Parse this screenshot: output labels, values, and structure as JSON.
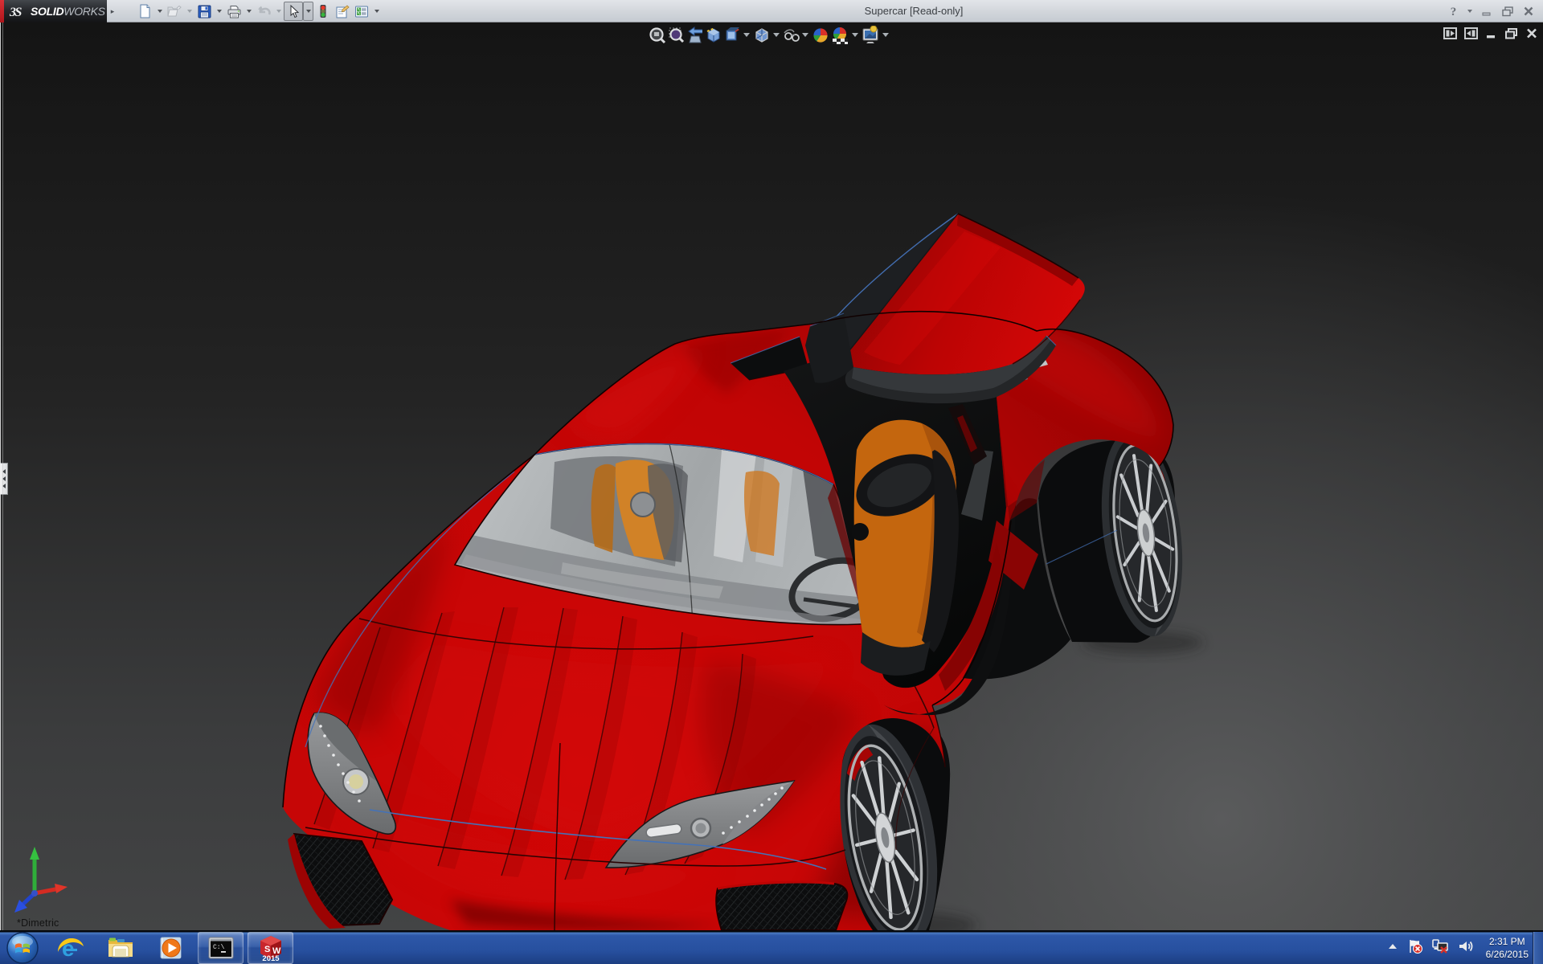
{
  "window": {
    "title": "Supercar [Read-only]",
    "brand": {
      "logo_glyph": "3S",
      "name_bold": "SOLID",
      "name_light": "WORKS",
      "flyout": "▸"
    },
    "controls": [
      {
        "name": "help-button",
        "label": "?"
      },
      {
        "name": "help-dropdown",
        "label": "▾"
      },
      {
        "name": "minimize-button",
        "label": "–"
      },
      {
        "name": "restore-button",
        "label": "⧉"
      },
      {
        "name": "close-button",
        "label": "✕"
      }
    ]
  },
  "quick_toolbar": {
    "items": [
      {
        "name": "new-document",
        "enabled": true,
        "has_dropdown": true
      },
      {
        "name": "open-document",
        "enabled": false,
        "has_dropdown": true
      },
      {
        "name": "save",
        "enabled": true,
        "has_dropdown": true
      },
      {
        "name": "print",
        "enabled": true,
        "has_dropdown": true
      },
      {
        "name": "undo",
        "enabled": false,
        "has_dropdown": true
      },
      {
        "name": "select",
        "enabled": true,
        "pressed": true,
        "has_dropdown": true
      },
      {
        "name": "rebuild",
        "enabled": true,
        "has_dropdown": false
      },
      {
        "name": "file-properties",
        "enabled": true,
        "has_dropdown": false
      },
      {
        "name": "options",
        "enabled": true,
        "has_dropdown": true
      }
    ]
  },
  "headsup_toolbar": {
    "items": [
      {
        "name": "zoom-to-fit"
      },
      {
        "name": "zoom-to-area"
      },
      {
        "name": "previous-view"
      },
      {
        "name": "section-view"
      },
      {
        "name": "view-orientation",
        "has_dropdown": true
      },
      {
        "name": "display-style",
        "has_dropdown": true
      },
      {
        "name": "hide-show-items",
        "has_dropdown": true
      },
      {
        "name": "edit-appearance"
      },
      {
        "name": "apply-scene",
        "has_dropdown": true
      },
      {
        "name": "view-settings",
        "has_dropdown": true
      }
    ]
  },
  "viewport": {
    "view_label": "*Dimetric",
    "model": "red supercar with open butterfly door, front three-quarter view",
    "triad_axes": {
      "x_color": "#e03028",
      "y_color": "#2fae3a",
      "z_color": "#2244dd"
    },
    "window_buttons": [
      {
        "name": "pane-left-toggle"
      },
      {
        "name": "pane-right-toggle"
      },
      {
        "name": "minimize-document"
      },
      {
        "name": "restore-document"
      },
      {
        "name": "close-document"
      }
    ],
    "feature_tree_tab": "collapsed"
  },
  "taskbar": {
    "start": "Start",
    "items": [
      {
        "name": "internet-explorer",
        "running": false
      },
      {
        "name": "windows-explorer",
        "running": false
      },
      {
        "name": "windows-media-player",
        "running": false
      },
      {
        "name": "command-prompt",
        "running": true,
        "label": "C:\\"
      },
      {
        "name": "solidworks-2015",
        "running": true,
        "label_top": "SW",
        "label_bottom": "2015"
      }
    ],
    "tray": {
      "icons": [
        {
          "name": "show-hidden-icons",
          "glyph": "▴"
        },
        {
          "name": "action-center-flag"
        },
        {
          "name": "network-status"
        },
        {
          "name": "volume"
        }
      ],
      "time": "2:31 PM",
      "date": "6/26/2015"
    },
    "show_desktop": ""
  },
  "colors": {
    "body_red": "#c30505",
    "body_red_bright": "#e20a0a",
    "body_red_dark": "#7a0202",
    "seat_orange": "#e07818",
    "edge_blue": "#4472b8",
    "taskbar_blue": "#2b55a5",
    "titlebar_gray": "#d4d8dd",
    "viewport_top": "#181818",
    "viewport_bottom": "#4a4b4c"
  }
}
